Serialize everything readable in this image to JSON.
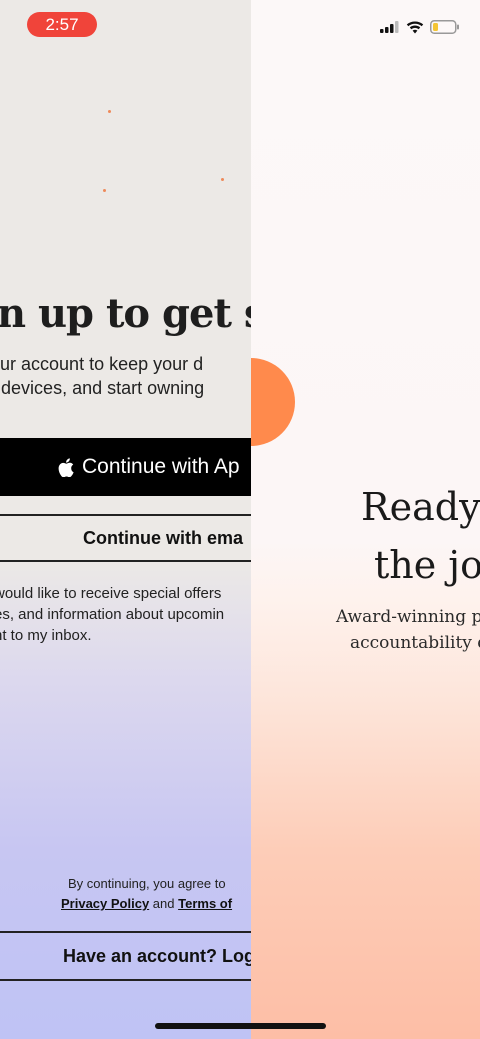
{
  "status_bar": {
    "time": "2:57"
  },
  "signup_screen": {
    "headline": "gn up to get st",
    "subtext_lines": [
      "e your account to keep your d",
      "een devices, and start owning"
    ],
    "apple_button_label": "Continue with Ap",
    "email_button_label": "Continue with ema",
    "offers_lines": [
      "would like to receive special offers",
      "es, and information about upcomin",
      "nt to my inbox."
    ],
    "terms_prefix": "By continuing, you agree to",
    "privacy_policy_label": "Privacy Policy",
    "terms_and": "and",
    "terms_of_label": "Terms of",
    "login_button_label": "Have an account? Log"
  },
  "onboarding_screen": {
    "title_lines": [
      "Ready",
      "the jou"
    ],
    "subtitle_lines": [
      "Award-winning pl",
      "accountability d"
    ]
  },
  "icons": {
    "apple": "apple-icon",
    "signal": "cellular-signal-icon",
    "wifi": "wifi-icon",
    "battery": "battery-icon"
  },
  "colors": {
    "time_pill": "#f0443a",
    "accent_orange": "#ff8a4c",
    "apple_button": "#000000"
  }
}
